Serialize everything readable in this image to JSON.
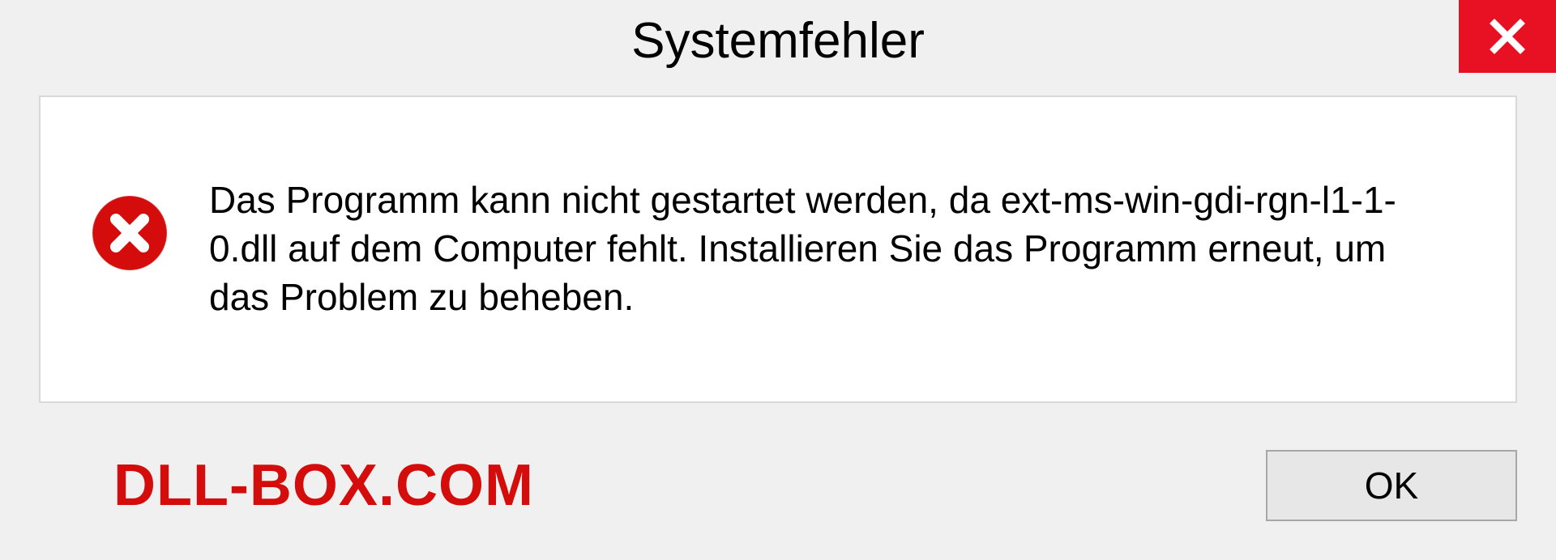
{
  "titlebar": {
    "title": "Systemfehler"
  },
  "message": {
    "text": "Das Programm kann nicht gestartet werden, da ext-ms-win-gdi-rgn-l1-1-0.dll auf dem Computer fehlt. Installieren Sie das Programm erneut, um das Problem zu beheben."
  },
  "footer": {
    "watermark": "DLL-BOX.COM",
    "ok_label": "OK"
  },
  "colors": {
    "close_bg": "#e81123",
    "error_icon": "#d40c0c",
    "watermark": "#d40c0c"
  }
}
